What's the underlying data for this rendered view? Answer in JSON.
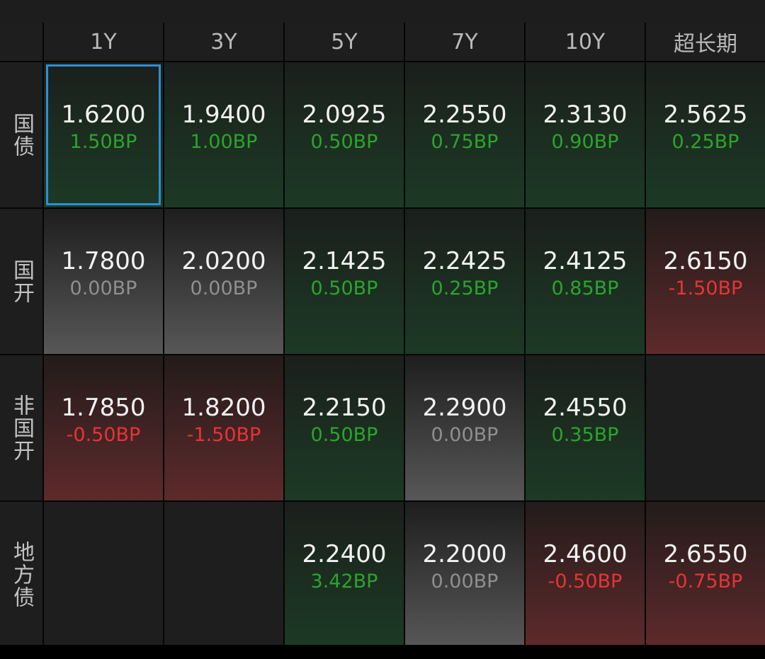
{
  "columns": [
    "1Y",
    "3Y",
    "5Y",
    "7Y",
    "10Y",
    "超长期"
  ],
  "rows": [
    {
      "label": "国\n债",
      "cells": [
        {
          "value": "1.6200",
          "change": "1.50BP",
          "trend": "up",
          "selected": true
        },
        {
          "value": "1.9400",
          "change": "1.00BP",
          "trend": "up"
        },
        {
          "value": "2.0925",
          "change": "0.50BP",
          "trend": "up"
        },
        {
          "value": "2.2550",
          "change": "0.75BP",
          "trend": "up"
        },
        {
          "value": "2.3130",
          "change": "0.90BP",
          "trend": "up"
        },
        {
          "value": "2.5625",
          "change": "0.25BP",
          "trend": "up"
        }
      ]
    },
    {
      "label": "国\n开",
      "cells": [
        {
          "value": "1.7800",
          "change": "0.00BP",
          "trend": "flat"
        },
        {
          "value": "2.0200",
          "change": "0.00BP",
          "trend": "flat"
        },
        {
          "value": "2.1425",
          "change": "0.50BP",
          "trend": "up"
        },
        {
          "value": "2.2425",
          "change": "0.25BP",
          "trend": "up"
        },
        {
          "value": "2.4125",
          "change": "0.85BP",
          "trend": "up"
        },
        {
          "value": "2.6150",
          "change": "-1.50BP",
          "trend": "down"
        }
      ]
    },
    {
      "label": "非\n国\n开",
      "cells": [
        {
          "value": "1.7850",
          "change": "-0.50BP",
          "trend": "down"
        },
        {
          "value": "1.8200",
          "change": "-1.50BP",
          "trend": "down"
        },
        {
          "value": "2.2150",
          "change": "0.50BP",
          "trend": "up"
        },
        {
          "value": "2.2900",
          "change": "0.00BP",
          "trend": "flat"
        },
        {
          "value": "2.4550",
          "change": "0.35BP",
          "trend": "up"
        },
        {
          "value": "",
          "change": "",
          "trend": "empty"
        }
      ]
    },
    {
      "label": "地\n方\n债",
      "cells": [
        {
          "value": "",
          "change": "",
          "trend": "empty"
        },
        {
          "value": "",
          "change": "",
          "trend": "empty"
        },
        {
          "value": "2.2400",
          "change": "3.42BP",
          "trend": "up"
        },
        {
          "value": "2.2000",
          "change": "0.00BP",
          "trend": "flat"
        },
        {
          "value": "2.4600",
          "change": "-0.50BP",
          "trend": "down"
        },
        {
          "value": "2.6550",
          "change": "-0.75BP",
          "trend": "down"
        }
      ]
    }
  ]
}
